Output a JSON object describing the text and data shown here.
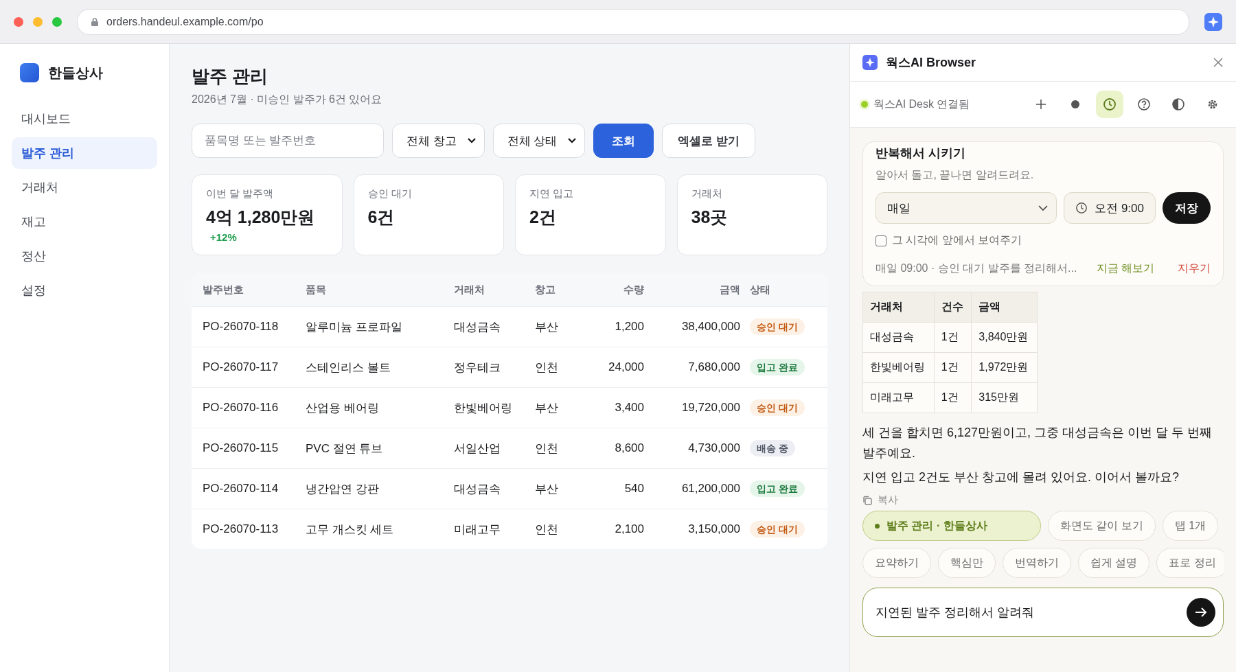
{
  "browser": {
    "url": "orders.handeul.example.com/po"
  },
  "sidebar": {
    "brand": "한들상사",
    "items": [
      {
        "label": "대시보드",
        "selected": false
      },
      {
        "label": "발주 관리",
        "selected": true
      },
      {
        "label": "거래처",
        "selected": false
      },
      {
        "label": "재고",
        "selected": false
      },
      {
        "label": "정산",
        "selected": false
      },
      {
        "label": "설정",
        "selected": false
      }
    ]
  },
  "page": {
    "title": "발주 관리",
    "subtitle": "2026년 7월 · 미승인 발주가 6건 있어요"
  },
  "filters": {
    "search": {
      "placeholder": "품목명 또는 발주번호"
    },
    "warehouse": "전체 창고",
    "status": "전체 상태",
    "query_button": "조회",
    "export_button": "엑셀로 받기"
  },
  "stats": [
    {
      "label": "이번 달 발주액",
      "value": "4억 1,280만원",
      "change": "+12%"
    },
    {
      "label": "승인 대기",
      "value": "6건"
    },
    {
      "label": "지연 입고",
      "value": "2건"
    },
    {
      "label": "거래처",
      "value": "38곳"
    }
  ],
  "table": {
    "columns": [
      "발주번호",
      "품목",
      "거래처",
      "창고",
      "수량",
      "금액",
      "상태"
    ],
    "rows": [
      {
        "cells": [
          "PO-26070-118",
          "알루미늄 프로파일",
          "대성금속",
          "부산",
          "1,200",
          "38,400,000"
        ],
        "status": {
          "label": "승인 대기",
          "kind": "pending"
        }
      },
      {
        "cells": [
          "PO-26070-117",
          "스테인리스 볼트",
          "정우테크",
          "인천",
          "24,000",
          "7,680,000"
        ],
        "status": {
          "label": "입고 완료",
          "kind": "received"
        }
      },
      {
        "cells": [
          "PO-26070-116",
          "산업용 베어링",
          "한빛베어링",
          "부산",
          "3,400",
          "19,720,000"
        ],
        "status": {
          "label": "승인 대기",
          "kind": "pending"
        }
      },
      {
        "cells": [
          "PO-26070-115",
          "PVC 절연 튜브",
          "서일산업",
          "인천",
          "8,600",
          "4,730,000"
        ],
        "status": {
          "label": "배송 중",
          "kind": "shipping"
        }
      },
      {
        "cells": [
          "PO-26070-114",
          "냉간압연 강판",
          "대성금속",
          "부산",
          "540",
          "61,200,000"
        ],
        "status": {
          "label": "입고 완료",
          "kind": "received"
        }
      },
      {
        "cells": [
          "PO-26070-113",
          "고무 개스킷 세트",
          "미래고무",
          "인천",
          "2,100",
          "3,150,000"
        ],
        "status": {
          "label": "승인 대기",
          "kind": "pending"
        }
      }
    ]
  },
  "assistant": {
    "title": "웍스AI Browser",
    "connection": {
      "label": "웍스AI Desk 연결됨",
      "on": true
    },
    "tools": [
      {
        "kind": "plus",
        "selected": false
      },
      {
        "kind": "record",
        "selected": false
      },
      {
        "kind": "clock",
        "selected": true
      },
      {
        "kind": "help",
        "selected": false
      },
      {
        "kind": "contrast",
        "selected": false
      },
      {
        "kind": "gear",
        "selected": false
      }
    ],
    "schedule": {
      "title": "반복해서 시키기",
      "note": "알아서 돌고, 끝나면 알려드려요.",
      "frequency": "매일",
      "time": "오전 9:00",
      "save_button": "저장",
      "show_option": {
        "label": "그 시각에 앞에서 보여주기",
        "checked": false
      },
      "summary": "매일 09:00 · 승인 대기 발주를 정리해서...",
      "run_link": "지금 해보기",
      "delete_link": "지우기"
    },
    "result_table": {
      "columns": [
        "거래처",
        "건수",
        "금액"
      ],
      "rows": [
        [
          "대성금속",
          "1건",
          "3,840만원"
        ],
        [
          "한빛베어링",
          "1건",
          "1,972만원"
        ],
        [
          "미래고무",
          "1건",
          "315만원"
        ]
      ]
    },
    "paragraphs": [
      "세 건을 합치면 6,127만원이고, 그중 대성금속은 이번 달 두 번째 발주예요.",
      "지연 입고 2건도 부산 창고에 몰려 있어요. 이어서 볼까요?"
    ],
    "copy_label": "복사",
    "context_chips": [
      {
        "label": "발주 관리 · 한들상사",
        "selected": true
      },
      {
        "label": "화면도 같이 보기",
        "selected": false
      },
      {
        "label": "탭 1개",
        "selected": false
      }
    ],
    "action_chips": [
      "요약하기",
      "핵심만",
      "번역하기",
      "쉽게 설명",
      "표로 정리"
    ],
    "input": {
      "value": "지연된 발주 정리해서 알려줘"
    }
  }
}
